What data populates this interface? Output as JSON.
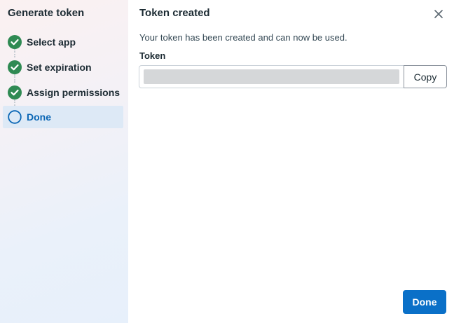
{
  "sidebar": {
    "title": "Generate token",
    "steps": [
      {
        "label": "Select app",
        "status": "complete",
        "icon": "check-circle-icon"
      },
      {
        "label": "Set expiration",
        "status": "complete",
        "icon": "check-circle-icon"
      },
      {
        "label": "Assign permissions",
        "status": "complete",
        "icon": "check-circle-icon"
      },
      {
        "label": "Done",
        "status": "current",
        "icon": "circle-outline-icon"
      }
    ]
  },
  "main": {
    "title": "Token created",
    "description": "Your token has been created and can now be used.",
    "token_label": "Token",
    "copy_label": "Copy",
    "done_label": "Done"
  },
  "colors": {
    "complete_green": "#2f8a53",
    "accent_blue": "#0a70c8",
    "active_step_bg": "#dde9f6"
  }
}
